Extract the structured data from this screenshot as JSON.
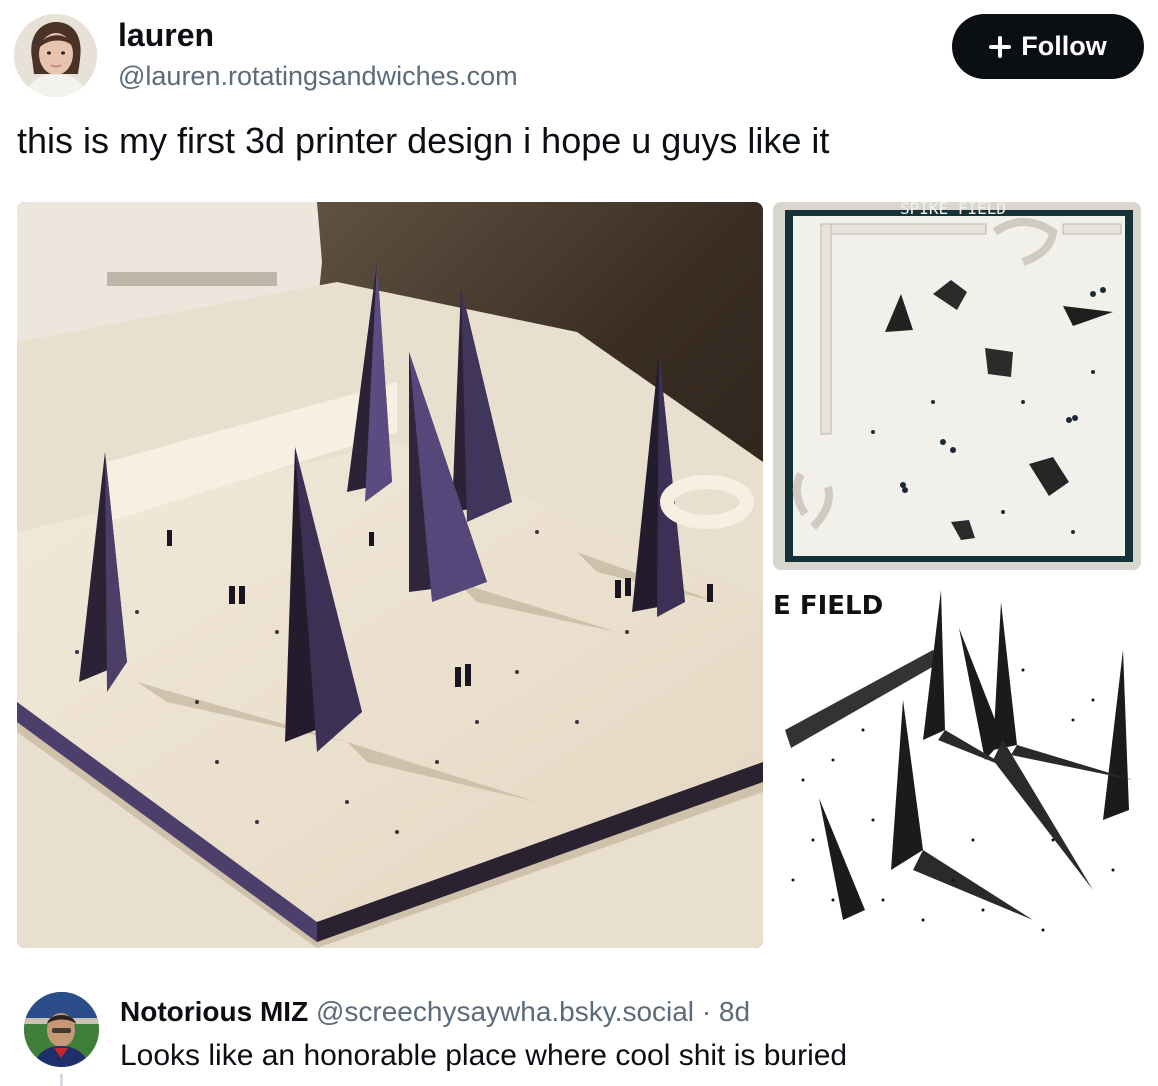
{
  "post": {
    "author_name": "lauren",
    "author_handle": "@lauren.rotatingsandwiches.com",
    "follow_label": "Follow",
    "text": "this is my first 3d printer design i hope u guys like it",
    "images": {
      "top_right_caption": "SPIKE FIELD",
      "bottom_right_caption": "E FIELD"
    }
  },
  "reply": {
    "author_name": "Notorious MIZ",
    "author_handle": "@screechysaywha.bsky.social",
    "separator": "·",
    "time": "8d",
    "text": "Looks like an honorable place where cool shit is buried"
  },
  "colors": {
    "accent": "#0b0f14",
    "secondary_text": "#5c6b7a"
  }
}
